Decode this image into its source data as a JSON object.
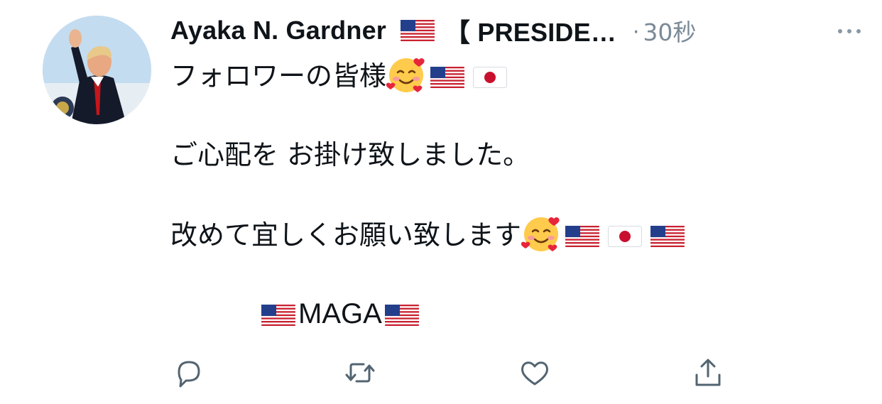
{
  "tweet": {
    "author": {
      "display_name": "Ayaka N. Gardner",
      "name_suffix": "【 PRESIDE…",
      "avatar_icon": "avatar-photo-icon"
    },
    "separator": "·",
    "timestamp": "30秒",
    "more_icon": "more-options-icon",
    "lines": {
      "line1": "フォロワーの皆様",
      "line2": "ご心配を お掛け致しました。",
      "line3": "改めて宜しくお願い致します",
      "line4": "MAGA"
    },
    "emoji": {
      "us_flag": "us-flag-icon",
      "jp_flag": "japan-flag-icon",
      "smiling_face_with_hearts": "smiling-face-with-hearts-icon"
    }
  },
  "actions": {
    "reply_icon": "reply-icon",
    "retweet_icon": "retweet-icon",
    "like_icon": "like-icon",
    "share_icon": "share-icon"
  },
  "colors": {
    "text": "#0f1419",
    "secondary": "#7b8a97",
    "icon": "#536471"
  }
}
